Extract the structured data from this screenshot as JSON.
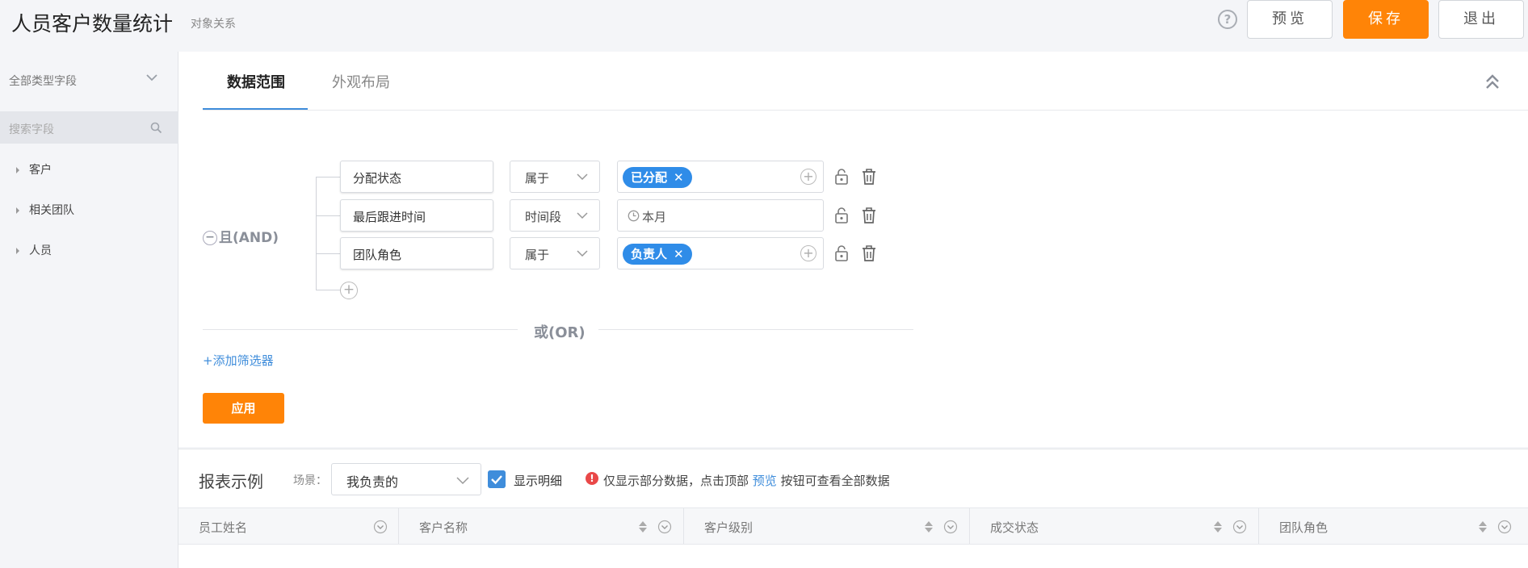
{
  "header": {
    "title": "人员客户数量统计",
    "subtitle": "对象关系",
    "help_glyph": "?",
    "preview_label": "预览",
    "save_label": "保存",
    "exit_label": "退出"
  },
  "sidebar": {
    "type_filter": "全部类型字段",
    "search_placeholder": "搜索字段",
    "items": [
      {
        "label": "客户"
      },
      {
        "label": "相关团队"
      },
      {
        "label": "人员"
      }
    ]
  },
  "tabs": [
    {
      "label": "数据范围",
      "active": true
    },
    {
      "label": "外观布局",
      "active": false
    }
  ],
  "filter": {
    "logic_label": "且(AND)",
    "or_label": "或(OR)",
    "add_filter_label": "+添加筛选器",
    "apply_label": "应用",
    "conditions": [
      {
        "field": "分配状态",
        "operator": "属于",
        "value_tag": "已分配",
        "value_text": ""
      },
      {
        "field": "最后跟进时间",
        "operator": "时间段",
        "value_tag": "",
        "value_text": "本月"
      },
      {
        "field": "团队角色",
        "operator": "属于",
        "value_tag": "负责人",
        "value_text": ""
      }
    ]
  },
  "report": {
    "title": "报表示例",
    "scene_label": "场景：",
    "scene_value": "我负责的",
    "show_detail_label": "显示明细",
    "show_detail_checked": true,
    "note_before": "仅显示部分数据，点击顶部",
    "note_link": "预览",
    "note_after": "按钮可查看全部数据",
    "columns": [
      {
        "label": "员工姓名"
      },
      {
        "label": "客户名称"
      },
      {
        "label": "客户级别"
      },
      {
        "label": "成交状态"
      },
      {
        "label": "团队角色"
      }
    ]
  },
  "colors": {
    "accent_orange": "#ff8407",
    "accent_blue": "#3f8ddb",
    "tag_blue": "#2f8ce8",
    "warning_red": "#e94848"
  }
}
